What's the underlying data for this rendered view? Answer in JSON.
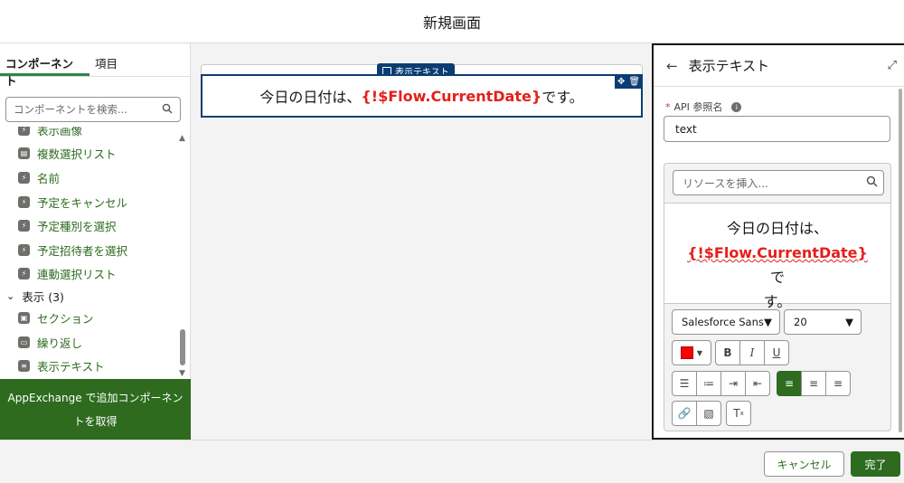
{
  "header": {
    "title": "新規画面"
  },
  "left_panel": {
    "tabs": [
      {
        "label": "コンポーネント",
        "active": true
      },
      {
        "label": "項目",
        "active": false
      }
    ],
    "search_placeholder": "コンポーネントを検索...",
    "partial_item": "表示画像",
    "items": [
      {
        "label": "複数選択リスト",
        "icon": "multi-select-icon"
      },
      {
        "label": "名前",
        "icon": "lightning-icon"
      },
      {
        "label": "予定をキャンセル",
        "icon": "lightning-icon"
      },
      {
        "label": "予定種別を選択",
        "icon": "lightning-icon"
      },
      {
        "label": "予定招待者を選択",
        "icon": "lightning-icon"
      },
      {
        "label": "連動選択リスト",
        "icon": "lightning-icon"
      }
    ],
    "section": {
      "label": "表示 (3)"
    },
    "display_items": [
      {
        "label": "セクション",
        "icon": "section-icon"
      },
      {
        "label": "繰り返し",
        "icon": "repeater-icon"
      },
      {
        "label": "表示テキスト",
        "icon": "display-text-icon"
      }
    ],
    "appexchange": {
      "line1": "AppExchange で追加コンポーネン",
      "line2": "トを取得"
    }
  },
  "canvas": {
    "field_tag": "表示テキスト",
    "text_before": "今日の日付は、",
    "merge_field": "{!$Flow.CurrentDate}",
    "text_after": "です。"
  },
  "properties": {
    "title": "表示テキスト",
    "api_label": "API 参照名",
    "api_value": "text",
    "resource_placeholder": "リソースを挿入...",
    "editor": {
      "line1": "今日の日付は、",
      "merge_field": "{!$Flow.CurrentDate}",
      "after_merge": "で",
      "line3": "す。"
    },
    "font_family": "Salesforce Sans",
    "font_size": "20",
    "text_color": "#ff0000"
  },
  "footer": {
    "cancel_label": "キャンセル",
    "done_label": "完了"
  }
}
